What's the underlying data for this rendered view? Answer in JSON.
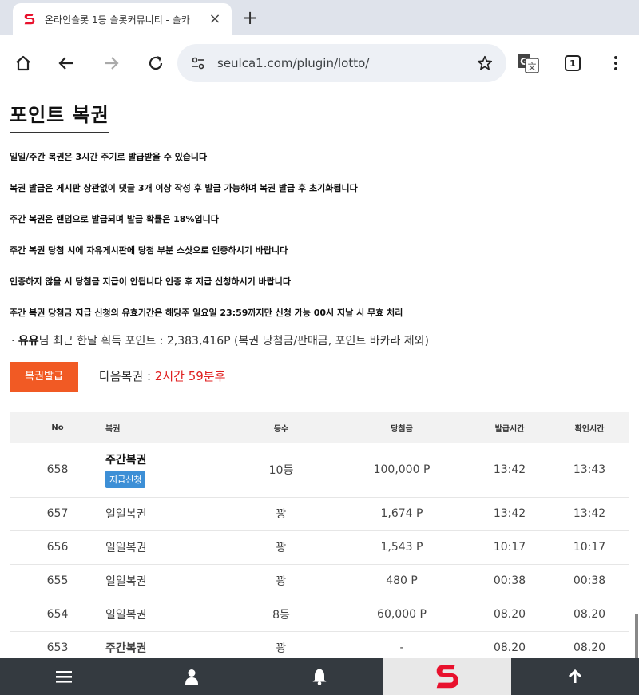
{
  "browser": {
    "tab_title": "온라인슬롯 1등 슬롯커뮤니티 - 슬카",
    "tab_close": "×",
    "new_tab": "+",
    "url": "seulca1.com/plugin/lotto/",
    "extension_badge": "1",
    "icons": [
      "site-logo-icon",
      "home-icon",
      "back-arrow-icon",
      "forward-arrow-icon",
      "reload-icon",
      "site-settings-icon",
      "star-icon",
      "translate-icon",
      "tab-count-icon",
      "more-vert-icon"
    ]
  },
  "page": {
    "title": "포인트 복권",
    "notices": [
      "일일/주간 복권은 3시간 주기로 발급받을 수 있습니다",
      "복권 발급은 게시판 상관없이 댓글 3개 이상 작성 후 발급 가능하며 복권 발급 후 초기화됩니다",
      "주간 복권은 랜덤으로 발급되며 발급 확률은 18%입니다",
      "주간 복권 당첨 시에 자유게시판에 당첨 부분 스샷으로 인증하시기 바랍니다",
      "인증하지 않을 시 당첨금 지급이 안됩니다 인증 후 지급 신청하시기 바랍니다",
      "주간 복권 당첨금 지급 신청의 유효기간은 해당주 일요일 23:59까지만 신청 가능 00시 지날 시 무효 처리"
    ],
    "summary": {
      "bullet": "·",
      "user": "유유",
      "text": "님 최근 한달 획득 포인트 : 2,383,416P (복권 당첨금/판매금, 포인트 바카라 제외)"
    },
    "issue_button": "복권발급",
    "next_label": "다음복권 : ",
    "next_time": "2시간 59분후"
  },
  "table": {
    "headers": [
      "No",
      "복권",
      "등수",
      "당첨금",
      "발급시간",
      "확인시간"
    ],
    "rows": [
      {
        "no": "658",
        "name": "주간복권",
        "claim": "지급신청",
        "rank": "10등",
        "prize": "100,000 P",
        "issued": "13:42",
        "checked": "13:43"
      },
      {
        "no": "657",
        "name": "일일복권",
        "rank": "꽝",
        "prize": "1,674 P",
        "issued": "13:42",
        "checked": "13:42"
      },
      {
        "no": "656",
        "name": "일일복권",
        "rank": "꽝",
        "prize": "1,543 P",
        "issued": "10:17",
        "checked": "10:17"
      },
      {
        "no": "655",
        "name": "일일복권",
        "rank": "꽝",
        "prize": "480 P",
        "issued": "00:38",
        "checked": "00:38"
      },
      {
        "no": "654",
        "name": "일일복권",
        "rank": "8등",
        "prize": "60,000 P",
        "issued": "08.20",
        "checked": "08.20"
      },
      {
        "no": "653",
        "name": "주간복권",
        "rank": "꽝",
        "prize": "-",
        "issued": "08.20",
        "checked": "08.20"
      }
    ]
  },
  "bottom_nav": [
    "menu-icon",
    "user-icon",
    "bell-icon",
    "site-logo-icon",
    "arrow-up-icon"
  ],
  "colors": {
    "accent_orange": "#f15a24",
    "claim_blue": "#3d8fd6",
    "countdown_red": "#e02020",
    "nav_dark": "#343a40",
    "logo_red": "#e8112d"
  }
}
